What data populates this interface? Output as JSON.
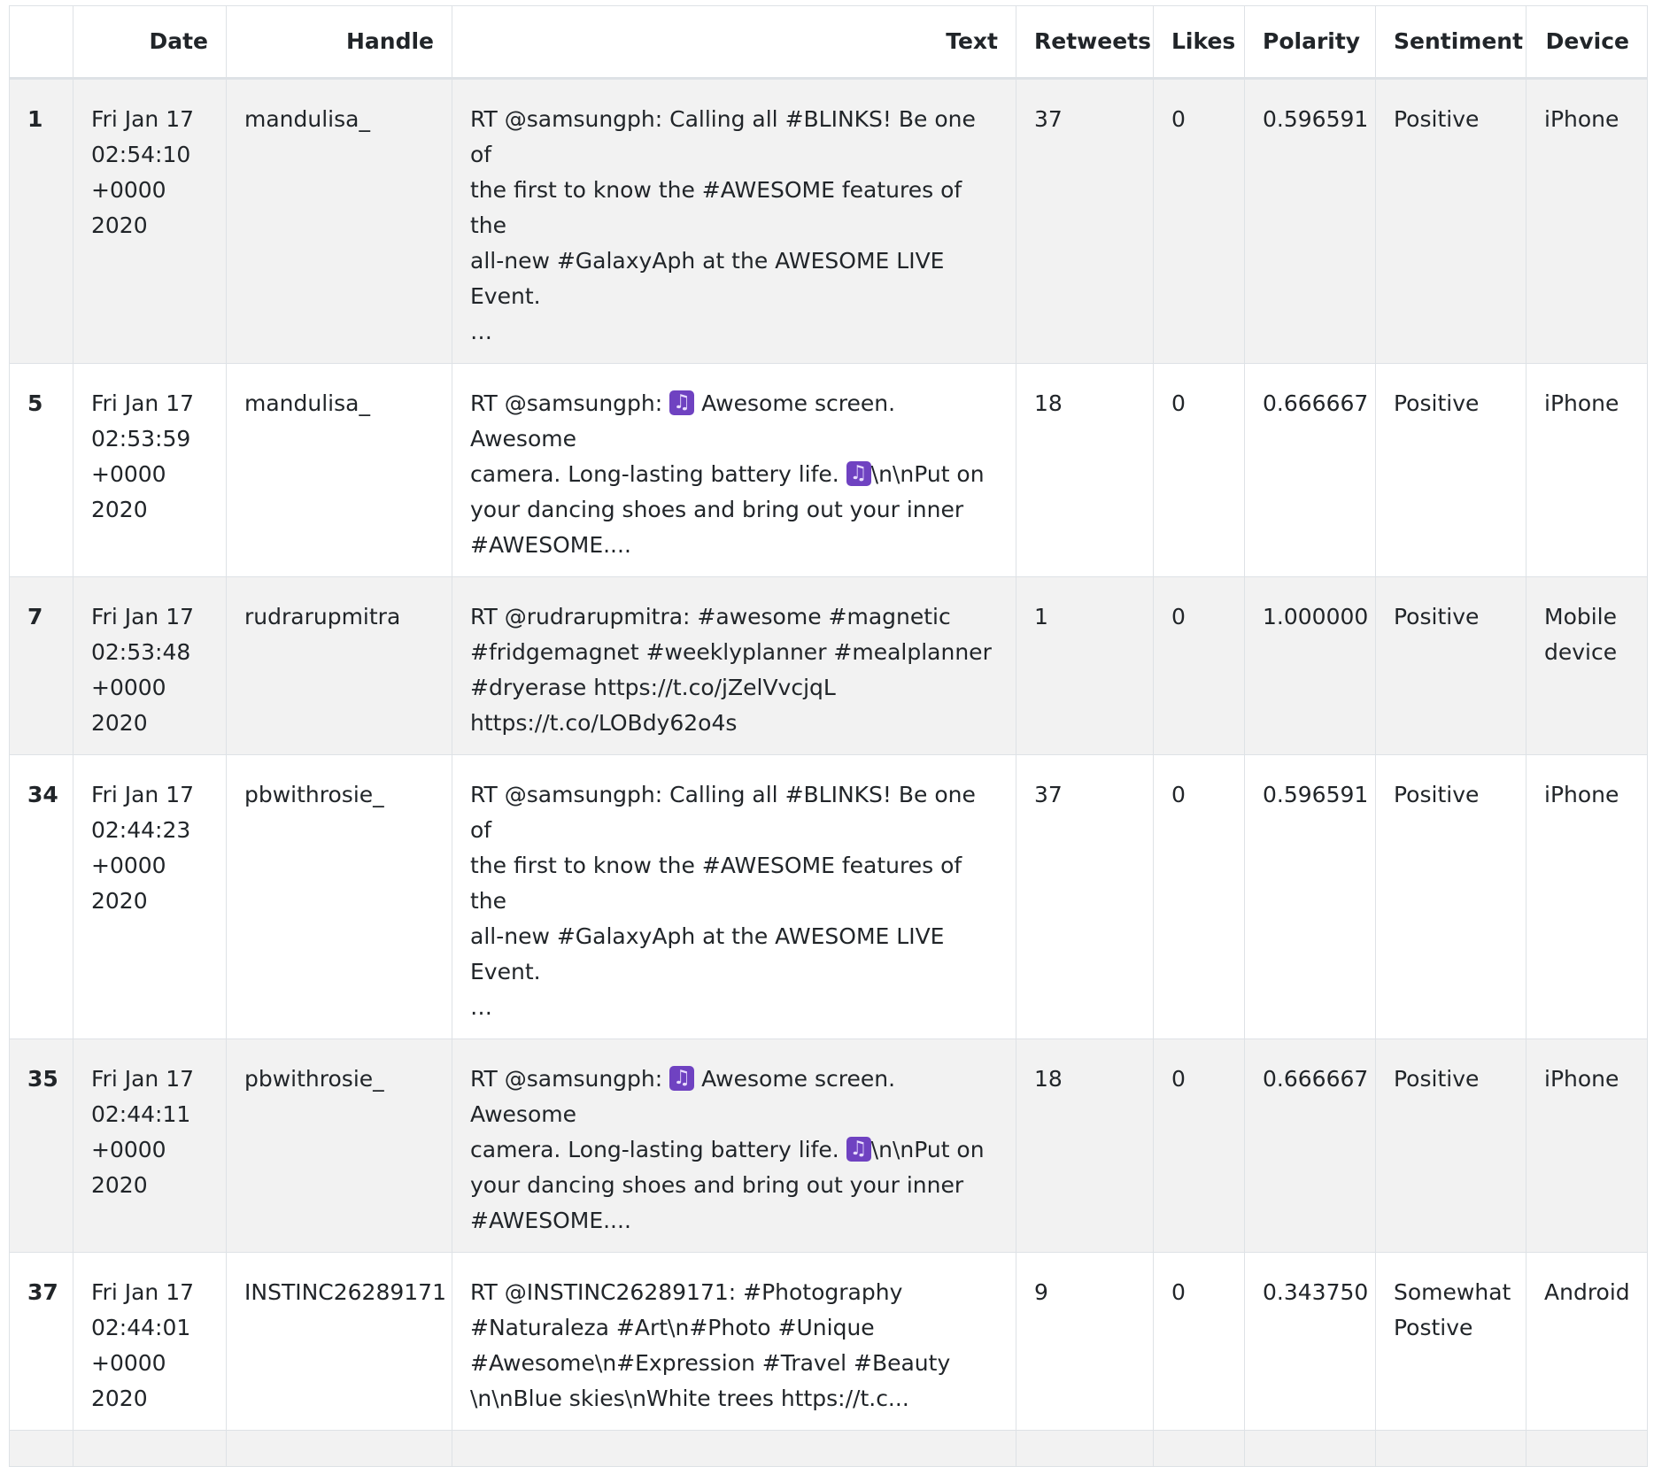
{
  "table": {
    "columns": [
      "",
      "Date",
      "Handle",
      "Text",
      "Retweets",
      "Likes",
      "Polarity",
      "Sentiment",
      "Device"
    ],
    "rows": [
      {
        "index": "1",
        "date": [
          "Fri Jan 17",
          "02:54:10",
          "+0000",
          "2020"
        ],
        "handle": "mandulisa_",
        "text": [
          "RT @samsungph: Calling all #BLINKS! Be one of",
          "the first to know the #AWESOME features of the",
          "all-new #GalaxyAph at the AWESOME LIVE Event.",
          "…"
        ],
        "retweets": "37",
        "likes": "0",
        "polarity": "0.596591",
        "sentiment": [
          "Positive"
        ],
        "device": [
          "iPhone"
        ]
      },
      {
        "index": "5",
        "date": [
          "Fri Jan 17",
          "02:53:59",
          "+0000",
          "2020"
        ],
        "handle": "mandulisa_",
        "text_parts": [
          {
            "pre": "RT @samsungph: ",
            "emoji": "music-emoji",
            "post": " Awesome screen. Awesome"
          },
          {
            "pre": "camera. Long-lasting battery life. ",
            "emoji": "music-emoji",
            "post": "\\n\\nPut on"
          },
          {
            "pre": "your dancing shoes and bring out your inner",
            "emoji": "",
            "post": ""
          },
          {
            "pre": "#AWESOME....",
            "emoji": "",
            "post": ""
          }
        ],
        "retweets": "18",
        "likes": "0",
        "polarity": "0.666667",
        "sentiment": [
          "Positive"
        ],
        "device": [
          "iPhone"
        ]
      },
      {
        "index": "7",
        "date": [
          "Fri Jan 17",
          "02:53:48",
          "+0000",
          "2020"
        ],
        "handle": "rudrarupmitra",
        "text": [
          "RT @rudrarupmitra: #awesome #magnetic",
          "#fridgemagnet #weeklyplanner #mealplanner",
          "#dryerase https://t.co/jZelVvcjqL",
          "https://t.co/LOBdy62o4s"
        ],
        "retweets": "1",
        "likes": "0",
        "polarity": "1.000000",
        "sentiment": [
          "Positive"
        ],
        "device": [
          "Mobile",
          "device"
        ]
      },
      {
        "index": "34",
        "date": [
          "Fri Jan 17",
          "02:44:23",
          "+0000",
          "2020"
        ],
        "handle": "pbwithrosie_",
        "text": [
          "RT @samsungph: Calling all #BLINKS! Be one of",
          "the first to know the #AWESOME features of the",
          "all-new #GalaxyAph at the AWESOME LIVE Event.",
          "…"
        ],
        "retweets": "37",
        "likes": "0",
        "polarity": "0.596591",
        "sentiment": [
          "Positive"
        ],
        "device": [
          "iPhone"
        ]
      },
      {
        "index": "35",
        "date": [
          "Fri Jan 17",
          "02:44:11",
          "+0000",
          "2020"
        ],
        "handle": "pbwithrosie_",
        "text_parts": [
          {
            "pre": "RT @samsungph: ",
            "emoji": "music-emoji",
            "post": " Awesome screen. Awesome"
          },
          {
            "pre": "camera. Long-lasting battery life. ",
            "emoji": "music-emoji",
            "post": "\\n\\nPut on"
          },
          {
            "pre": "your dancing shoes and bring out your inner",
            "emoji": "",
            "post": ""
          },
          {
            "pre": "#AWESOME....",
            "emoji": "",
            "post": ""
          }
        ],
        "retweets": "18",
        "likes": "0",
        "polarity": "0.666667",
        "sentiment": [
          "Positive"
        ],
        "device": [
          "iPhone"
        ]
      },
      {
        "index": "37",
        "date": [
          "Fri Jan 17",
          "02:44:01",
          "+0000",
          "2020"
        ],
        "handle": "INSTINC26289171",
        "text": [
          "RT @INSTINC26289171: #Photography",
          "#Naturaleza #Art\\n#Photo #Unique",
          "#Awesome\\n#Expression #Travel #Beauty",
          "\\n\\nBlue skies\\nWhite trees https://t.c..."
        ],
        "retweets": "9",
        "likes": "0",
        "polarity": "0.343750",
        "sentiment": [
          "Somewhat",
          "Postive"
        ],
        "device": [
          "Android"
        ]
      }
    ]
  }
}
